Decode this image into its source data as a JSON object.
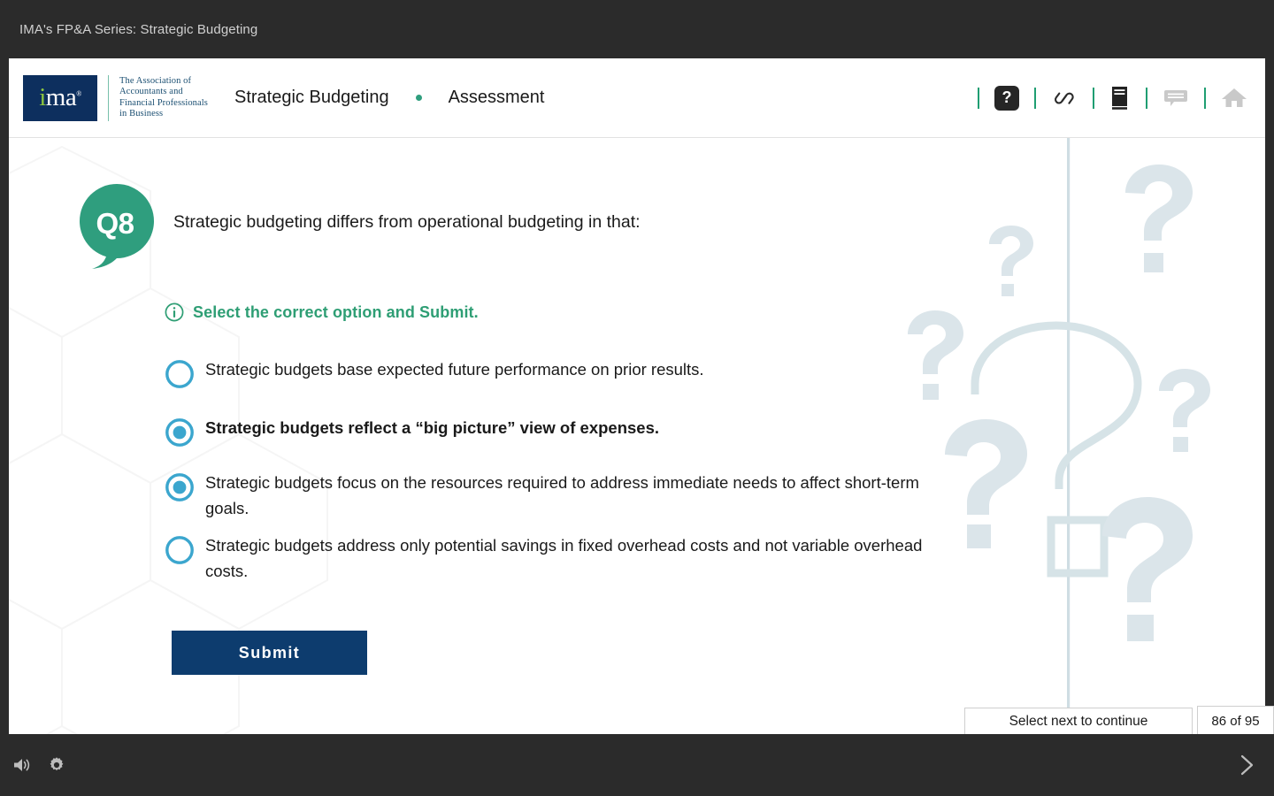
{
  "course_bar": {
    "title": "IMA's FP&A Series: Strategic Budgeting"
  },
  "header": {
    "logo": {
      "mark_text": "ima",
      "registered": "®",
      "tagline": "The Association of\nAccountants and\nFinancial Professionals\nin Business"
    },
    "title": "Strategic Budgeting",
    "subtitle": "Assessment",
    "icons": [
      {
        "name": "help-icon",
        "glyph": "?",
        "label": "Help"
      },
      {
        "name": "link-icon",
        "label": "Resources link"
      },
      {
        "name": "book-icon",
        "label": "Glossary"
      },
      {
        "name": "comment-icon",
        "label": "Notes"
      },
      {
        "name": "home-icon",
        "label": "Home"
      }
    ]
  },
  "question": {
    "number_badge": "Q8",
    "prompt": "Strategic budgeting differs from operational budgeting in that:",
    "instruction": "Select the correct option and Submit.",
    "options": [
      {
        "id": "opt-1",
        "text": "Strategic budgets base expected future performance on prior results.",
        "selected": false,
        "emphasized": false
      },
      {
        "id": "opt-2",
        "text": "Strategic budgets reflect a “big picture” view of expenses.",
        "selected": true,
        "emphasized": true
      },
      {
        "id": "opt-3",
        "text": "Strategic budgets focus on the resources required to address immediate needs to affect short-term goals.",
        "selected": true,
        "emphasized": false
      },
      {
        "id": "opt-4",
        "text": "Strategic budgets address only potential savings in fixed overhead costs and not variable overhead costs.",
        "selected": false,
        "emphasized": false
      }
    ],
    "submit_label": "Submit"
  },
  "status": {
    "next_hint": "Select next to continue",
    "slide_counter": "86 of 95"
  },
  "player": {
    "volume_label": "Volume",
    "settings_label": "Settings",
    "next_label": "Next"
  },
  "colors": {
    "accent_teal": "#2f9e7e",
    "accent_green_text": "#2e9e74",
    "radio_blue": "#3ba6ce",
    "submit_navy": "#0d3c6e",
    "logo_navy": "#0d2f5e",
    "logo_green": "#8dc63f",
    "chrome_dark": "#2b2b2b",
    "qmark_decor": "#d3dfe4"
  }
}
